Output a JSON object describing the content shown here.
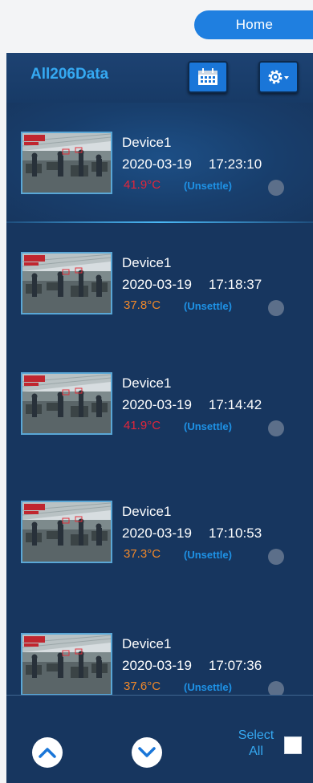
{
  "top": {
    "home_label": "Home"
  },
  "header": {
    "title": "All206Data"
  },
  "records": [
    {
      "device": "Device1",
      "date": "2020-03-19",
      "time": "17:23:10",
      "temp": "41.9°C",
      "temp_color": "#e3253a",
      "status": "(Unsettle)",
      "selected": true
    },
    {
      "device": "Device1",
      "date": "2020-03-19",
      "time": "17:18:37",
      "temp": "37.8°C",
      "temp_color": "#f0882a",
      "status": "(Unsettle)",
      "selected": false
    },
    {
      "device": "Device1",
      "date": "2020-03-19",
      "time": "17:14:42",
      "temp": "41.9°C",
      "temp_color": "#e3253a",
      "status": "(Unsettle)",
      "selected": false
    },
    {
      "device": "Device1",
      "date": "2020-03-19",
      "time": "17:10:53",
      "temp": "37.3°C",
      "temp_color": "#f0882a",
      "status": "(Unsettle)",
      "selected": false
    },
    {
      "device": "Device1",
      "date": "2020-03-19",
      "time": "17:07:36",
      "temp": "37.6°C",
      "temp_color": "#f0882a",
      "status": "(Unsettle)",
      "selected": false
    }
  ],
  "footer": {
    "select_all_label": "Select All"
  },
  "icons": {
    "calendar": "calendar-icon",
    "settings": "gear-icon",
    "up": "chevron-up-icon",
    "down": "chevron-down-icon"
  },
  "colors": {
    "accent": "#1f7fe0",
    "panel": "#17365f",
    "status": "#1e92e6"
  }
}
